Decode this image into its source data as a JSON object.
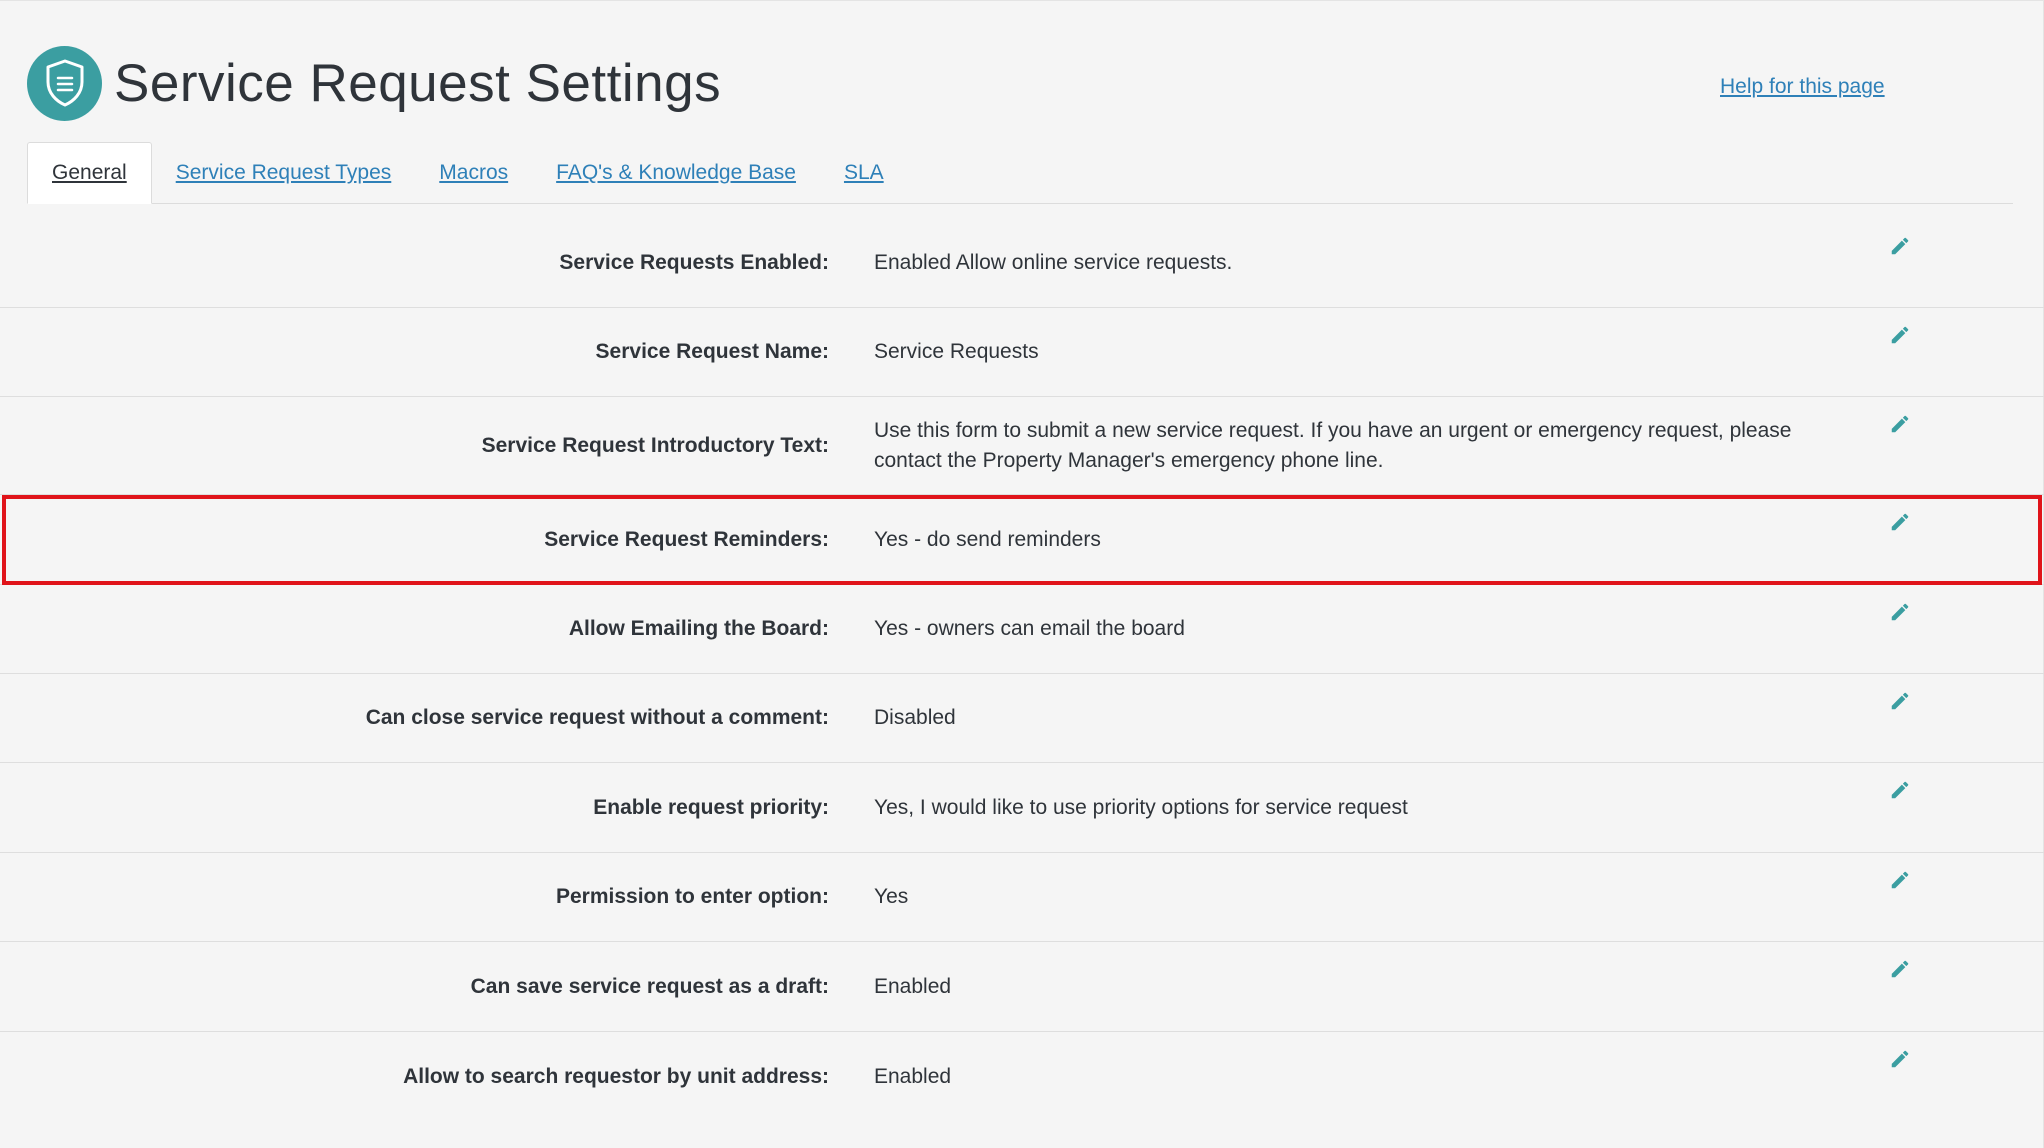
{
  "header": {
    "title": "Service Request Settings",
    "icon": "shield-icon",
    "help_link": "Help for this page"
  },
  "tabs": [
    {
      "label": "General",
      "active": true
    },
    {
      "label": "Service Request Types",
      "active": false
    },
    {
      "label": "Macros",
      "active": false
    },
    {
      "label": "FAQ's & Knowledge Base",
      "active": false
    },
    {
      "label": "SLA",
      "active": false
    }
  ],
  "settings": [
    {
      "label": "Service Requests Enabled:",
      "value": "Enabled Allow online service requests."
    },
    {
      "label": "Service Request Name:",
      "value": "Service Requests"
    },
    {
      "label": "Service Request Introductory Text:",
      "value": "Use this form to submit a new service request. If you have an urgent or emergency request, please contact the Property Manager's emergency phone line."
    },
    {
      "label": "Service Request Reminders:",
      "value": "Yes - do send reminders",
      "highlighted": true
    },
    {
      "label": "Allow Emailing the Board:",
      "value": "Yes - owners can email the board"
    },
    {
      "label": "Can close service request without a comment:",
      "value": "Disabled"
    },
    {
      "label": "Enable request priority:",
      "value": "Yes, I would like to use priority options for service request"
    },
    {
      "label": "Permission to enter option:",
      "value": "Yes"
    },
    {
      "label": "Can save service request as a draft:",
      "value": "Enabled"
    },
    {
      "label": "Allow to search requestor by unit address:",
      "value": "Enabled"
    }
  ],
  "colors": {
    "accent": "#3b9ea1",
    "link": "#2e80b8",
    "highlight_border": "#e0141a",
    "background": "#f5f5f5"
  }
}
